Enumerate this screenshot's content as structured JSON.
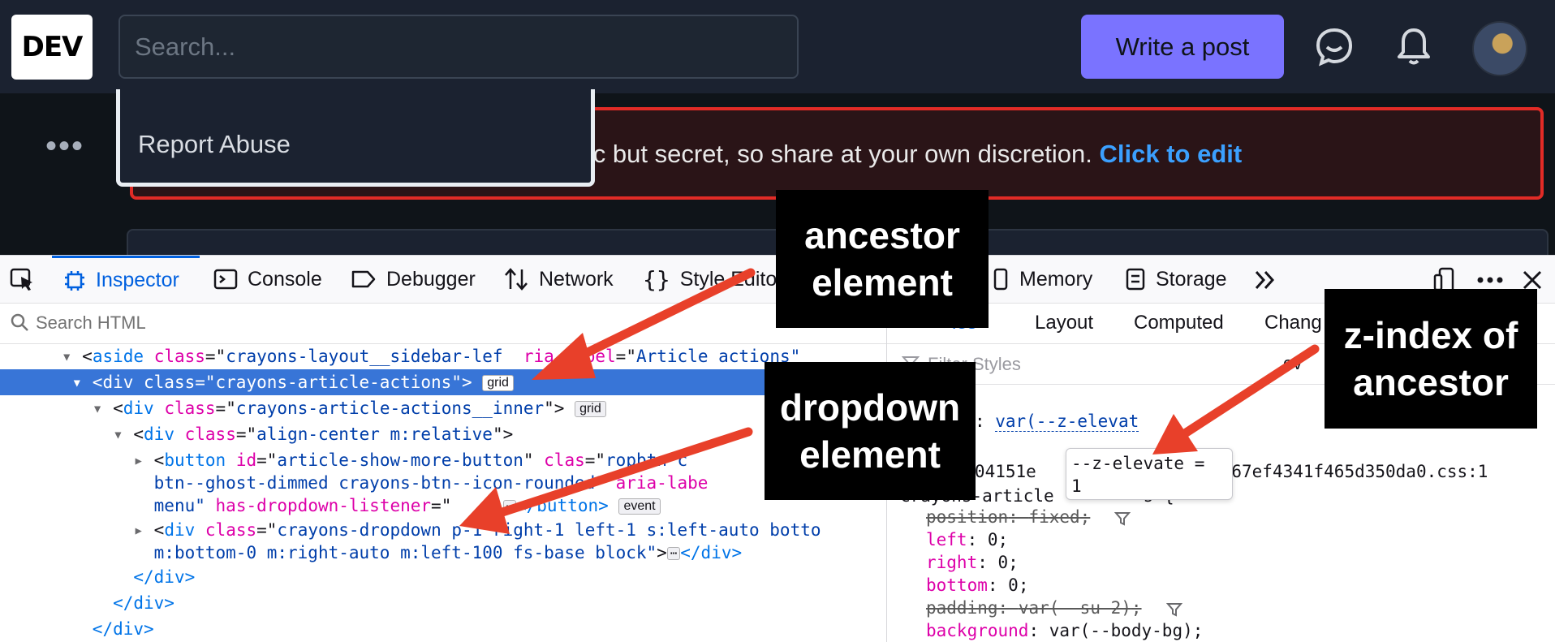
{
  "site": {
    "logo": "DEV",
    "search_placeholder": "Search...",
    "write_post_label": "Write a post",
    "more_dots": "•••",
    "dropdown_item": "Report Abuse",
    "banner_text": "lic but secret, so share at your own discretion.",
    "banner_link": "Click to edit",
    "icons": [
      "chat-icon",
      "bell-icon",
      "avatar"
    ]
  },
  "devtools": {
    "tabs": [
      {
        "label": "Inspector",
        "icon": "inspector-icon",
        "active": true
      },
      {
        "label": "Console",
        "icon": "console-icon"
      },
      {
        "label": "Debugger",
        "icon": "debugger-icon"
      },
      {
        "label": "Network",
        "icon": "network-icon"
      },
      {
        "label": "Style Edito",
        "icon": "style-editor-icon"
      },
      {
        "label": "Memory",
        "icon": "memory-icon"
      },
      {
        "label": "Storage",
        "icon": "storage-icon"
      }
    ],
    "search_html_placeholder": "Search HTML",
    "rules_tabs": [
      "les",
      "Layout",
      "Computed",
      "Chang"
    ],
    "filter_placeholder": "Filter Styles",
    "filter_right": "ov",
    "markup": {
      "l1": {
        "tag": "aside",
        "attr1": "class",
        "val1": "crayons-layout__sidebar-lef",
        "attr2": "ria-label",
        "val2": "Article actions\""
      },
      "l2": {
        "text": "<div class=\"crayons-article-actions\">",
        "badge": "grid"
      },
      "l3": {
        "tag": "div",
        "attr": "class",
        "val": "crayons-article-actions__inner",
        "badge": "grid"
      },
      "l4": {
        "tag": "div",
        "attr": "class",
        "val": "align-center m:relative"
      },
      "l5": {
        "tag": "button",
        "attr1": "id",
        "val1": "article-show-more-button",
        "attr2": "clas",
        "val2": "ropbtn c"
      },
      "l6": {
        "val": "btn--ghost-dimmed crayons-btn--icon-rounded\"",
        "attr": "aria-labe"
      },
      "l7": {
        "val": "menu\"",
        "attr": "has-dropdown-listener",
        "rest": "=\"",
        "close": "</button>",
        "badge": "event"
      },
      "l8": {
        "tag": "div",
        "attr": "class",
        "val": "crayons-dropdown p-1 right-1 left-1 s:left-auto botto"
      },
      "l9": {
        "val": "m:bottom-0 m:right-auto m:left-100 fs-base block\"",
        "close": "</div>"
      },
      "l10": "</div>",
      "l11": "</div>",
      "l12": "</div>"
    },
    "rules": {
      "r0": "));",
      "r1_prop": "dex",
      "r1_val": "var(--z-elevat",
      "r2": "15e04151e",
      "r2b": "2f4967ef4341f465d350da0.css:1",
      "r3": "crayons-article",
      "r3b": "s {",
      "decls": [
        {
          "prop": "position",
          "value": "fixed",
          "struck": true
        },
        {
          "prop": "left",
          "value": "0"
        },
        {
          "prop": "right",
          "value": "0"
        },
        {
          "prop": "bottom",
          "value": "0"
        },
        {
          "prop": "padding",
          "value": "var(--su-2)",
          "struck": true
        },
        {
          "prop": "background",
          "value": "var(--body-bg)"
        }
      ]
    },
    "tooltip_line1": "--z-elevate =",
    "tooltip_line2": "1"
  },
  "annotations": {
    "ancestor_l1": "ancestor",
    "ancestor_l2": "element",
    "dropdown_l1": "dropdown",
    "dropdown_l2": "element",
    "zindex_l1": "z-index of",
    "zindex_l2": "ancestor",
    "arrow_color": "#e8402a"
  }
}
